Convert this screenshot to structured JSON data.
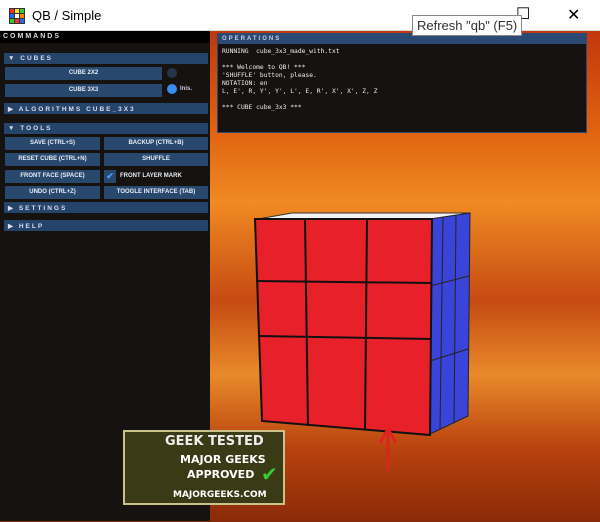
{
  "window": {
    "title": "QB / Simple",
    "tooltip": "Refresh \"qb\" (F5)"
  },
  "commands": {
    "title": "COMMANDS",
    "cubes": {
      "label": "CUBES",
      "btn_2x2": "CUBE 2X2",
      "btn_3x3": "CUBE 3X3",
      "radio_label": "Inis."
    },
    "algorithms": {
      "label": "ALGORITHMS CUBE_3X3"
    },
    "tools": {
      "label": "TOOLS",
      "save": "SAVE (CTRL+S)",
      "backup": "BACKUP (CTRL+B)",
      "reset": "RESET CUBE (CTRL+N)",
      "shuffle": "SHUFFLE",
      "front_face": "FRONT FACE (SPACE)",
      "front_layer_mark": "FRONT LAYER MARK",
      "undo": "UNDO (CTRL+Z)",
      "toggle": "TOOGLE INTERFACE (TAB)"
    },
    "settings": {
      "label": "SETTINGS"
    },
    "help": {
      "label": "HELP"
    }
  },
  "operations": {
    "title": "OPERATIONS",
    "log": "RUNNING  cube_3x3_made_with.txt\n\n*** Welcome to QB! ***\n'SHUFFLE' button, please.\nNOTATION: en\nL, E', R, Y', Y', L', E, R', X', X', Z, Z\n\n*** CUBE cube_3x3 ***"
  },
  "watermark": {
    "line1": "GEEK TESTED",
    "line2": "MAJOR GEEKS",
    "line3": "APPROVED",
    "line4": "MAJORGEEKS.COM"
  },
  "colors": {
    "front": "#e8202a",
    "right": "#3a44d8",
    "top": "#f2f2f2",
    "panel": "#151210",
    "button": "#29486e",
    "accent": "#3a8cf0"
  }
}
